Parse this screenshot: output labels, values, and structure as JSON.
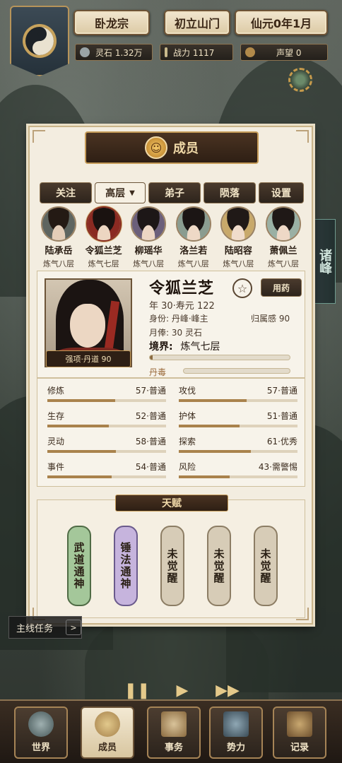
{
  "top": {
    "sect": "卧龙宗",
    "stage": "初立山门",
    "date": "仙元0年1月",
    "stats": [
      {
        "label": "灵石 1.32万",
        "icon": "spirit-stone-icon"
      },
      {
        "label": "战力 1117",
        "icon": "sword-icon"
      },
      {
        "label": "声望 0",
        "icon": "reputation-icon"
      }
    ]
  },
  "panel": {
    "title": "成员",
    "tabs": [
      "关注",
      "高层",
      "弟子",
      "陨落",
      "设置"
    ],
    "members": [
      {
        "name": "陆承岳",
        "level": "炼气八层"
      },
      {
        "name": "令狐兰芝",
        "level": "炼气七层"
      },
      {
        "name": "柳瑶华",
        "level": "炼气八层"
      },
      {
        "name": "洛兰若",
        "level": "炼气八层"
      },
      {
        "name": "陆昭容",
        "level": "炼气八层"
      },
      {
        "name": "萧佩兰",
        "level": "炼气八层"
      }
    ],
    "detail": {
      "name": "令狐兰芝",
      "strength": "强项·丹道 90",
      "med_button": "用药",
      "age": "年 30·寿元 122",
      "identity": "身份: 丹峰·峰主",
      "belong": "归属感 90",
      "salary": "月俸: 30 灵石",
      "realm_label": "境界:",
      "realm": "炼气七层",
      "poison_label": "丹毒",
      "cultivation_progress": 0.02,
      "poison_progress": 0.0
    },
    "stats": [
      {
        "name": "修炼",
        "value": "57·普通",
        "pct": 57
      },
      {
        "name": "攻伐",
        "value": "57·普通",
        "pct": 57
      },
      {
        "name": "生存",
        "value": "52·普通",
        "pct": 52
      },
      {
        "name": "护体",
        "value": "51·普通",
        "pct": 51
      },
      {
        "name": "灵动",
        "value": "58·普通",
        "pct": 58
      },
      {
        "name": "探索",
        "value": "61·优秀",
        "pct": 61
      },
      {
        "name": "事件",
        "value": "54·普通",
        "pct": 54
      },
      {
        "name": "风险",
        "value": "43·需警惕",
        "pct": 43
      }
    ],
    "talent_title": "天赋",
    "talents": [
      {
        "text": "武道通神",
        "tone": "green"
      },
      {
        "text": "锤法通神",
        "tone": "purple"
      },
      {
        "text": "未觉醒",
        "tone": "grey"
      },
      {
        "text": "未觉醒",
        "tone": "grey"
      },
      {
        "text": "未觉醒",
        "tone": "grey"
      }
    ]
  },
  "side_tag": "诸峰",
  "quest": {
    "label": "主线任务",
    "chevron": ">"
  },
  "controls": [
    "❚❚",
    "▶",
    "▶▶"
  ],
  "nav": [
    {
      "label": "世界",
      "icon": "world-icon"
    },
    {
      "label": "成员",
      "icon": "member-icon"
    },
    {
      "label": "事务",
      "icon": "affairs-icon"
    },
    {
      "label": "势力",
      "icon": "faction-icon"
    },
    {
      "label": "记录",
      "icon": "records-icon"
    }
  ]
}
